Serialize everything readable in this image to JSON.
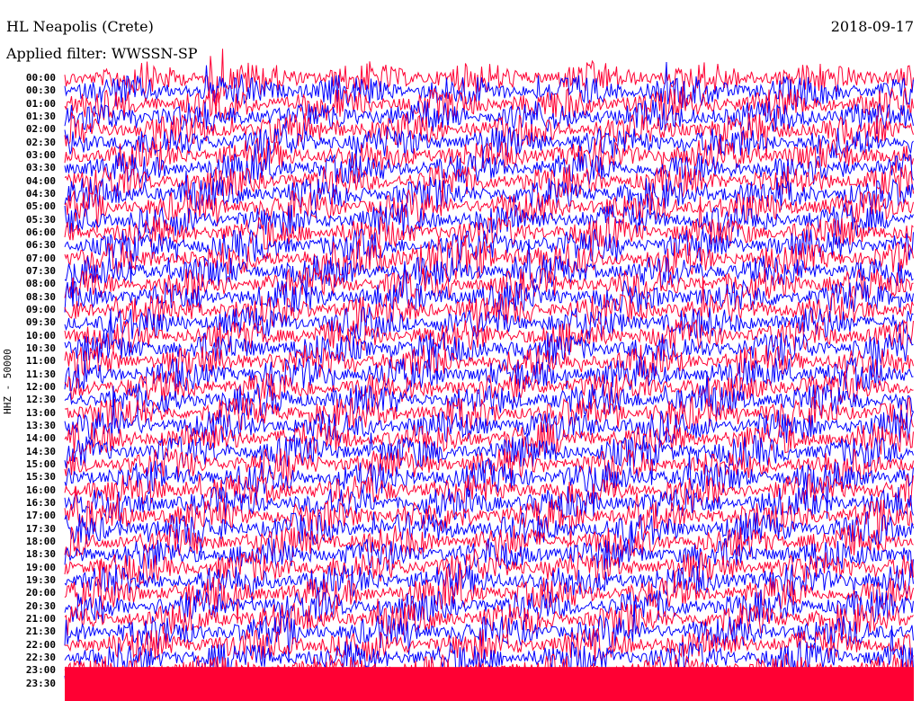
{
  "header": {
    "station": "HL Neapolis (Crete)",
    "filter": "Applied filter: WWSSN-SP",
    "date": "2018-09-17"
  },
  "chart_data": {
    "type": "line",
    "subtype": "helicorder",
    "title": "HL Neapolis (Crete)",
    "ylabel": "HHZ - 50000",
    "xlabel": "",
    "colors": [
      "#ff0033",
      "#0000ff"
    ],
    "row_labels": [
      "00:00",
      "00:30",
      "01:00",
      "01:30",
      "02:00",
      "02:30",
      "03:00",
      "03:30",
      "04:00",
      "04:30",
      "05:00",
      "05:30",
      "06:00",
      "06:30",
      "07:00",
      "07:30",
      "08:00",
      "08:30",
      "09:00",
      "09:30",
      "10:00",
      "10:30",
      "11:00",
      "11:30",
      "12:00",
      "12:30",
      "13:00",
      "13:30",
      "14:00",
      "14:30",
      "15:00",
      "15:30",
      "16:00",
      "16:30",
      "17:00",
      "17:30",
      "18:00",
      "18:30",
      "19:00",
      "19:30",
      "20:00",
      "20:30",
      "21:00",
      "21:30",
      "22:00",
      "22:30",
      "23:00",
      "23:30"
    ],
    "row_minutes": 30,
    "noise_amplitude": 1.0,
    "events": [
      {
        "row": "00:00",
        "start_fraction": 0.17,
        "end_fraction": 0.19,
        "amplitude": 3.5
      },
      {
        "row": "07:00",
        "start_fraction": 0.34,
        "end_fraction": 0.535,
        "amplitude": 1.6
      }
    ]
  }
}
